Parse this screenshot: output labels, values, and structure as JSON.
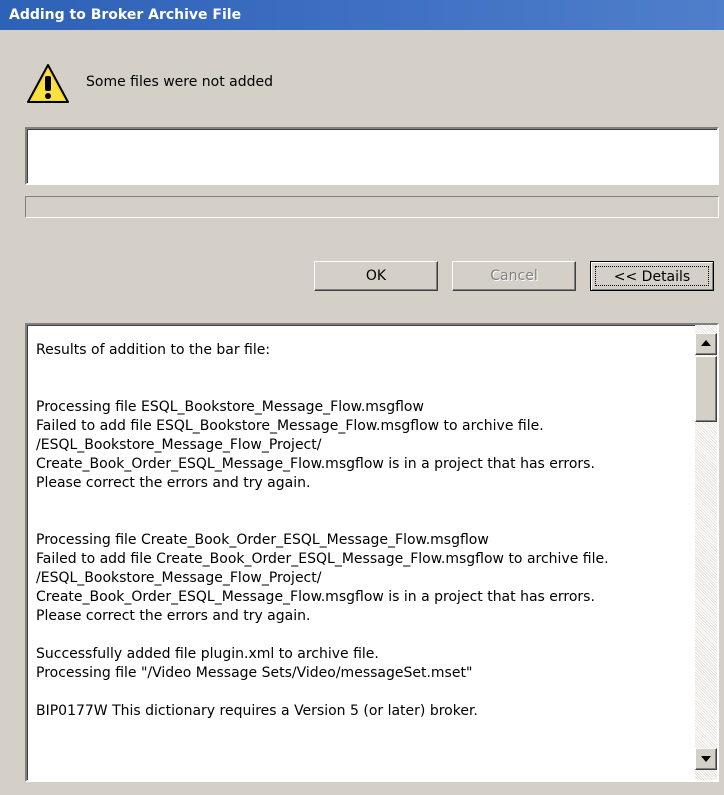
{
  "window": {
    "title": "Adding to Broker Archive File"
  },
  "message": {
    "icon": "warning-icon",
    "text": "Some files were not added"
  },
  "status_field": {
    "value": ""
  },
  "progress": {
    "value": 0
  },
  "buttons": {
    "ok_label": "OK",
    "cancel_label": "Cancel",
    "details_label": "<< Details"
  },
  "details": {
    "lines": [
      "Results of addition to the bar file:",
      "",
      "",
      "Processing file ESQL_Bookstore_Message_Flow.msgflow",
      "Failed to add file ESQL_Bookstore_Message_Flow.msgflow to archive file.",
      "/ESQL_Bookstore_Message_Flow_Project/",
      "Create_Book_Order_ESQL_Message_Flow.msgflow is in a project that has errors.",
      "Please correct the errors and try again.",
      "",
      "",
      "Processing file Create_Book_Order_ESQL_Message_Flow.msgflow",
      "Failed to add file Create_Book_Order_ESQL_Message_Flow.msgflow to archive file.",
      "/ESQL_Bookstore_Message_Flow_Project/",
      "Create_Book_Order_ESQL_Message_Flow.msgflow is in a project that has errors.",
      "Please correct the errors and try again.",
      "",
      "Successfully added file plugin.xml to archive file.",
      "Processing file \"/Video Message Sets/Video/messageSet.mset\"",
      "",
      "BIP0177W This dictionary requires a Version 5 (or later) broker."
    ]
  },
  "colors": {
    "titlebar": "#3a6cc0",
    "dialog_bg": "#d4d0c8",
    "warning_yellow": "#f8d820"
  }
}
